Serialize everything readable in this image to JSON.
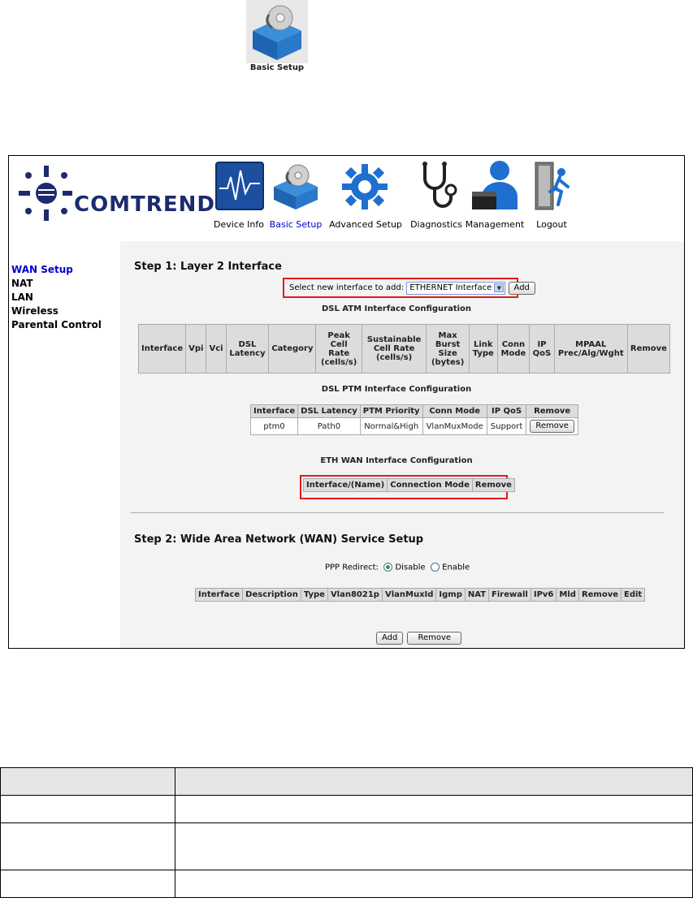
{
  "doc_icon": {
    "label": "Basic Setup",
    "icon": "basic-setup-icon"
  },
  "logo": {
    "text": "COMTREND"
  },
  "nav": [
    {
      "label": "Device Info",
      "icon": "device-info-icon"
    },
    {
      "label": "Basic Setup",
      "icon": "basic-setup-icon",
      "active": true
    },
    {
      "label": "Advanced Setup",
      "icon": "gear-icon"
    },
    {
      "label": "Diagnostics",
      "icon": "stethoscope-icon"
    },
    {
      "label": "Management",
      "icon": "user-icon"
    },
    {
      "label": "Logout",
      "icon": "exit-door-icon"
    }
  ],
  "sidebar": {
    "items": [
      "WAN Setup",
      "NAT",
      "LAN",
      "Wireless",
      "Parental Control"
    ]
  },
  "step1": {
    "title": "Step 1: Layer 2 Interface",
    "select_label": "Select new interface to add:",
    "select_value": "ETHERNET Interface",
    "add_label": "Add"
  },
  "dsl_atm": {
    "caption": "DSL ATM Interface Configuration",
    "headers": [
      "Interface",
      "Vpi",
      "Vci",
      "DSL Latency",
      "Category",
      "Peak Cell Rate (cells/s)",
      "Sustainable Cell Rate (cells/s)",
      "Max Burst Size (bytes)",
      "Link Type",
      "Conn Mode",
      "IP QoS",
      "MPAAL Prec/Alg/Wght",
      "Remove"
    ]
  },
  "dsl_ptm": {
    "caption": "DSL PTM Interface Configuration",
    "headers": [
      "Interface",
      "DSL Latency",
      "PTM Priority",
      "Conn Mode",
      "IP QoS",
      "Remove"
    ],
    "row": [
      "ptm0",
      "Path0",
      "Normal&High",
      "VlanMuxMode",
      "Support"
    ],
    "remove_label": "Remove"
  },
  "eth_wan": {
    "caption": "ETH WAN Interface Configuration",
    "headers": [
      "Interface/(Name)",
      "Connection Mode",
      "Remove"
    ]
  },
  "step2": {
    "title": "Step 2: Wide Area Network (WAN) Service Setup",
    "ppp_label": "PPP Redirect:",
    "disable_label": "Disable",
    "enable_label": "Enable",
    "headers": [
      "Interface",
      "Description",
      "Type",
      "Vlan8021p",
      "VlanMuxId",
      "Igmp",
      "NAT",
      "Firewall",
      "IPv6",
      "Mld",
      "Remove",
      "Edit"
    ],
    "add_label": "Add",
    "remove_label": "Remove"
  }
}
